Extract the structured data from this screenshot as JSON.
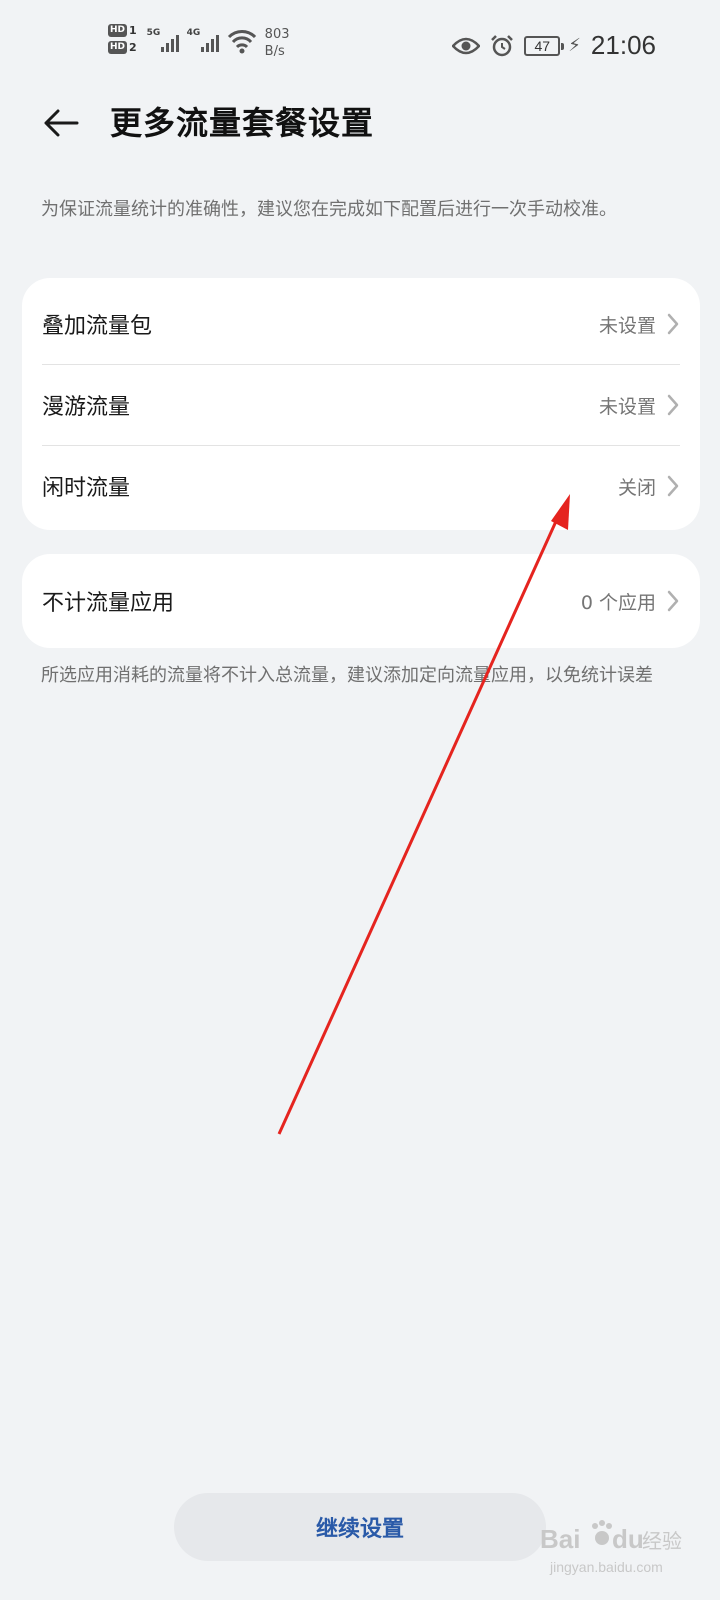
{
  "status_bar": {
    "sim1": "1",
    "sim2": "2",
    "hd": "HD",
    "net1": "5G",
    "net2": "4G",
    "speed_value": "803",
    "speed_unit": "B/s",
    "battery": "47",
    "time": "21:06",
    "icons": [
      "signal-icon",
      "wifi-icon",
      "eye-icon",
      "alarm-icon",
      "battery-icon",
      "charging-icon"
    ]
  },
  "header": {
    "title": "更多流量套餐设置"
  },
  "hint_top": "为保证流量统计的准确性，建议您在完成如下配置后进行一次手动校准。",
  "settings": {
    "rows": [
      {
        "label": "叠加流量包",
        "value": "未设置"
      },
      {
        "label": "漫游流量",
        "value": "未设置"
      },
      {
        "label": "闲时流量",
        "value": "关闭"
      }
    ]
  },
  "exempt": {
    "label": "不计流量应用",
    "value": "0 个应用"
  },
  "hint_bottom": "所选应用消耗的流量将不计入总流量，建议添加定向流量应用，以免统计误差",
  "continue_button": "继续设置",
  "watermark": {
    "brand": "Bai",
    "brand2": "du",
    "suffix": "经验",
    "url": "jingyan.baidu.com"
  },
  "colors": {
    "background": "#f1f3f5",
    "card": "#ffffff",
    "accent": "#2a5aa8",
    "annotation": "#e5241f"
  }
}
